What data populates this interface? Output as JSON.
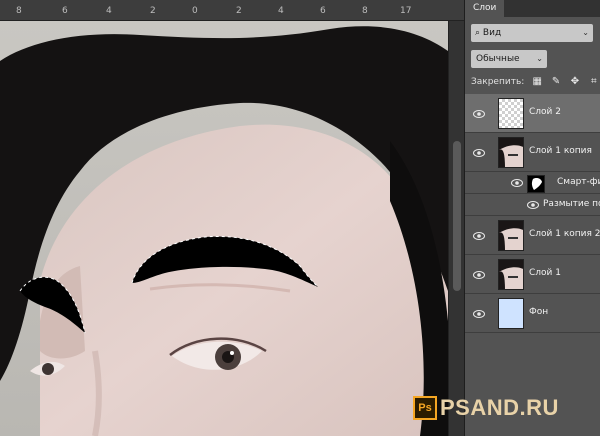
{
  "ruler": {
    "ticks": [
      "8",
      "6",
      "4",
      "2",
      "0",
      "2",
      "4",
      "6",
      "8",
      "10",
      "12",
      "14",
      "16",
      "17"
    ]
  },
  "panel": {
    "tab_label": "Слои",
    "search": {
      "icon": "search-icon",
      "value": "Вид"
    },
    "blend_mode": "Обычные",
    "lock_label": "Закрепить:",
    "lock_icons": [
      "checker-lock-icon",
      "brush-lock-icon",
      "move-lock-icon",
      "crop-lock-icon"
    ]
  },
  "layers": [
    {
      "name": "Слой 2",
      "thumb": "transparent",
      "selected": true,
      "visible": true
    },
    {
      "name": "Слой 1 копия",
      "thumb": "face",
      "selected": false,
      "visible": true
    },
    {
      "name": "Смарт-фи",
      "thumb": "mask",
      "sub": true,
      "visible": true
    },
    {
      "name": "Размытие по",
      "thumb": "none",
      "sub": true,
      "visible": true
    },
    {
      "name": "Слой 1 копия 2",
      "thumb": "face",
      "selected": false,
      "visible": true
    },
    {
      "name": "Слой 1",
      "thumb": "face",
      "selected": false,
      "visible": true
    },
    {
      "name": "Фон",
      "thumb": "blue",
      "selected": false,
      "visible": true
    }
  ],
  "watermark": {
    "badge": "Ps",
    "text": "PSAND.RU"
  },
  "colors": {
    "panel_bg": "#535353",
    "selected_row": "#6e6e6e",
    "watermark_accent": "#f5a623"
  }
}
